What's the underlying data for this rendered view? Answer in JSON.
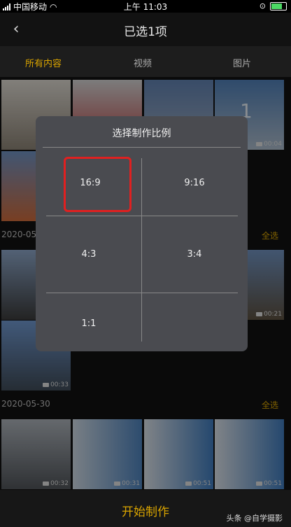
{
  "status_bar": {
    "carrier": "中国移动",
    "time": "上午 11:03"
  },
  "nav": {
    "title": "已选1项"
  },
  "tabs": [
    {
      "label": "所有内容",
      "active": true
    },
    {
      "label": "视频",
      "active": false
    },
    {
      "label": "图片",
      "active": false
    }
  ],
  "sections": [
    {
      "date": "2020-05",
      "select_all": "全选"
    },
    {
      "date": "2020-05-30",
      "select_all": "全选"
    }
  ],
  "thumb_durations": {
    "r1c4": "00:04",
    "r3c4": "00:21",
    "r4c1": "00:33",
    "r5c1": "00:32",
    "r5c2": "00:31",
    "r5c3": "00:51",
    "r5c4": "00:51"
  },
  "selected_badge": "1",
  "dialog": {
    "title": "选择制作比例",
    "options": [
      "16:9",
      "9:16",
      "4:3",
      "3:4",
      "1:1"
    ],
    "selected": "16:9"
  },
  "bottom": {
    "start_label": "开始制作",
    "watermark": "头条 @自学摄影"
  },
  "colors": {
    "accent": "#d9a400",
    "highlight": "#e02020",
    "dialog_bg": "#4a4b50",
    "background": "#121212"
  }
}
